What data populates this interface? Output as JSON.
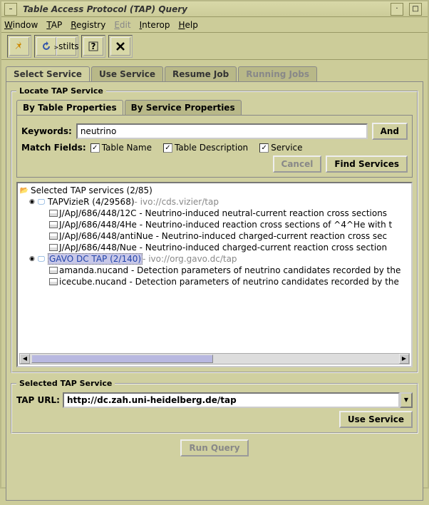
{
  "window": {
    "title": "Table Access Protocol (TAP) Query"
  },
  "menubar": [
    "Window",
    "TAP",
    "Registry",
    "Edit",
    "Interop",
    "Help"
  ],
  "menubar_disabled": [
    3
  ],
  "toolbar": {
    "pin": "pin-icon",
    "reload": "reload-icon",
    "stilts": "stilts",
    "help": "help-icon",
    "close": "close-icon"
  },
  "tabs": {
    "select": "Select Service",
    "use": "Use Service",
    "resume": "Resume Job",
    "running": "Running Jobs"
  },
  "locate": {
    "legend": "Locate TAP Service",
    "by_table": "By Table Properties",
    "by_service": "By Service Properties",
    "keywords_label": "Keywords:",
    "keywords_value": "neutrino",
    "and": "And",
    "match_label": "Match Fields:",
    "ck_table_name": "Table Name",
    "ck_table_desc": "Table Description",
    "ck_service": "Service",
    "cancel": "Cancel",
    "find": "Find Services"
  },
  "tree": {
    "root": "Selected TAP services (2/85)",
    "svc1": {
      "name": "TAPVizieR (4/29568)",
      "ivo": " - ivo://cds.vizier/tap"
    },
    "svc1_tables": [
      "J/ApJ/686/448/12C - Neutrino-induced neutral-current reaction cross sections",
      "J/ApJ/686/448/4He - Neutrino-induced reaction cross sections of ^4^He with t",
      "J/ApJ/686/448/antiNue - Neutrino-induced charged-current reaction cross sec",
      "J/ApJ/686/448/Nue - Neutrino-induced charged-current reaction cross section"
    ],
    "svc2": {
      "name": "GAVO DC TAP (2/140)",
      "ivo": " - ivo://org.gavo.dc/tap"
    },
    "svc2_tables": [
      "amanda.nucand - Detection parameters of neutrino candidates recorded by the",
      "icecube.nucand - Detection parameters of neutrino candidates recorded by the"
    ]
  },
  "selected": {
    "legend": "Selected TAP Service",
    "url_label": "TAP URL:",
    "url_value": "http://dc.zah.uni-heidelberg.de/tap",
    "use_btn": "Use Service"
  },
  "run": "Run Query"
}
